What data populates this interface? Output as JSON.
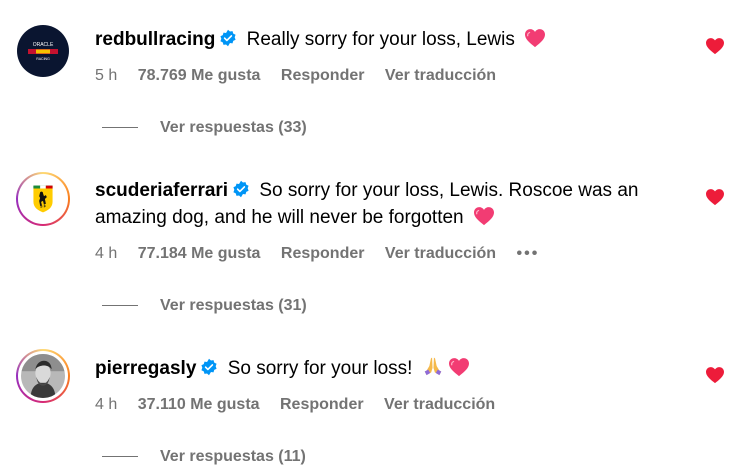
{
  "comments": [
    {
      "username": "redbullracing",
      "text": "Really sorry for your loss, Lewis",
      "time": "5 h",
      "likes": "78.769 Me gusta",
      "reply_label": "Responder",
      "translate_label": "Ver traducción",
      "replies_label": "Ver respuestas (33)",
      "emoji_icons": [
        "pink-heart-icon"
      ]
    },
    {
      "username": "scuderiaferrari",
      "text": "So sorry for your loss, Lewis. Roscoe was an amazing dog, and he will never be forgotten",
      "time": "4 h",
      "likes": "77.184 Me gusta",
      "reply_label": "Responder",
      "translate_label": "Ver traducción",
      "more_label": "•••",
      "replies_label": "Ver respuestas (31)",
      "emoji_icons": [
        "pink-heart-icon"
      ]
    },
    {
      "username": "pierregasly",
      "text": "So sorry for your loss!",
      "time": "4 h",
      "likes": "37.110 Me gusta",
      "reply_label": "Responder",
      "translate_label": "Ver traducción",
      "replies_label": "Ver respuestas (11)",
      "emoji_icons": [
        "folded-hands-icon",
        "pink-heart-icon"
      ]
    }
  ],
  "colors": {
    "like_heart": "#ed1c3a",
    "verified": "#0095f6",
    "secondary_text": "#737373",
    "emoji_heart": "#f23c73"
  }
}
